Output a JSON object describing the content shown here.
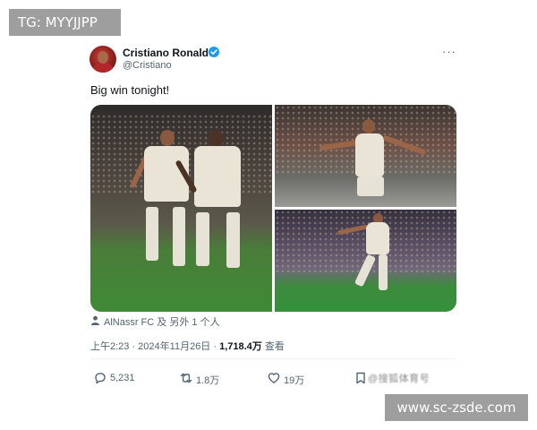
{
  "watermarks": {
    "top_left": "TG: MYYJJPP",
    "bottom_right": "www.sc-zsde.com"
  },
  "tweet": {
    "author_name": "Cristiano Ronaldo",
    "handle": "@Cristiano",
    "verified": true,
    "more_label": "···",
    "text": "Big win tonight!",
    "tagged": "AlNassr FC 及 另外 1 个人",
    "time": "上午2:23 · 2024年11月26日 · ",
    "views_count": "1,718.4万",
    "views_label": " 查看"
  },
  "actions": {
    "replies": "5,231",
    "retweets": "1.8万",
    "likes": "19万",
    "bookmark_blurred": "@搜狐体育号"
  },
  "icons": {
    "verified": "verified-badge-icon",
    "more": "more-options-icon",
    "person": "person-icon",
    "reply": "reply-icon",
    "retweet": "retweet-icon",
    "like": "heart-icon",
    "bookmark": "bookmark-icon"
  },
  "colors": {
    "accent": "#1d9bf0",
    "text_primary": "#0f1419",
    "text_secondary": "#536471",
    "watermark_bg": "#9e9e9e"
  }
}
